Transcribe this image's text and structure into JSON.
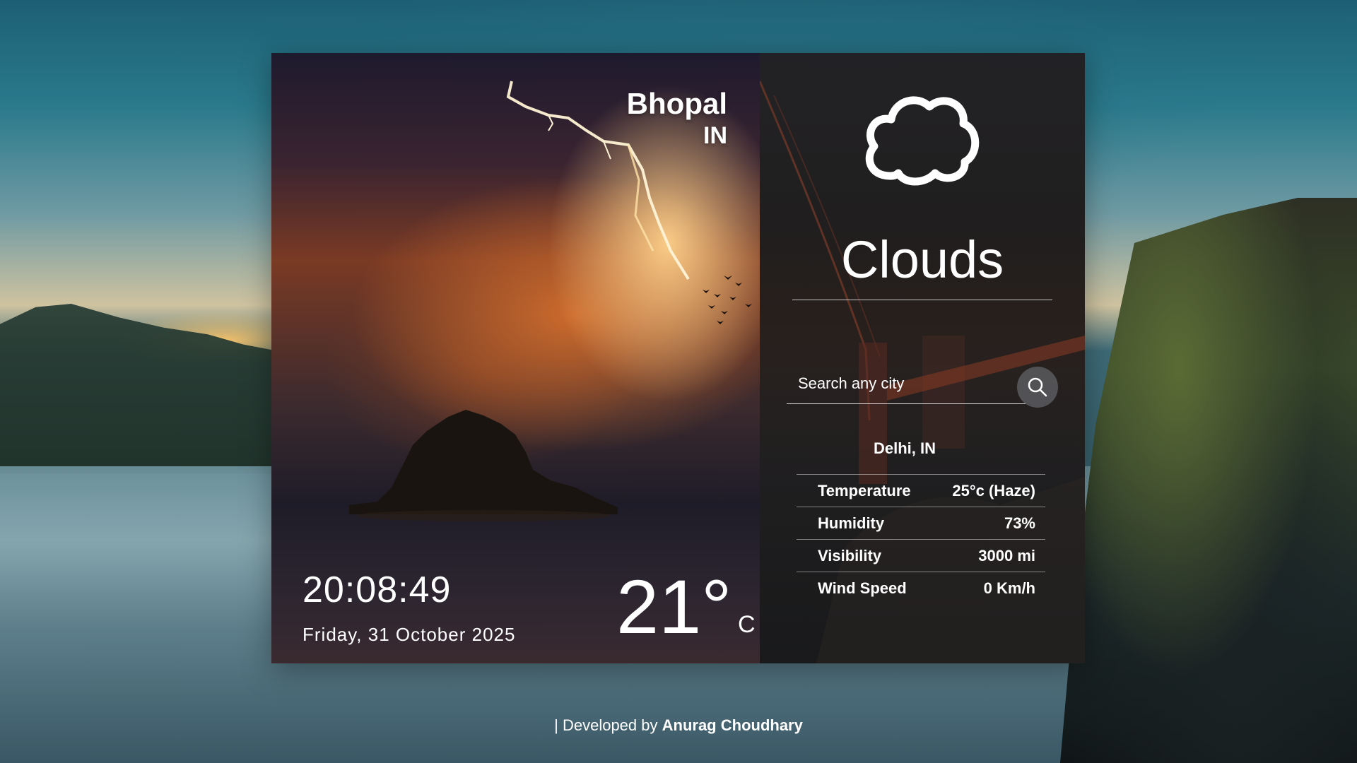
{
  "location_panel": {
    "city": "Bhopal",
    "country": "IN",
    "time": "20:08:49",
    "date": "Friday, 31 October 2025",
    "temperature": "21°",
    "temperature_unit": "C"
  },
  "weather_panel": {
    "icon": "cloud-icon",
    "condition": "Clouds",
    "search": {
      "placeholder": "Search any city"
    },
    "result_location": "Delhi, IN",
    "stats": [
      {
        "label": "Temperature",
        "value": "25°c (Haze)"
      },
      {
        "label": "Humidity",
        "value": "73%"
      },
      {
        "label": "Visibility",
        "value": "3000 mi"
      },
      {
        "label": "Wind Speed",
        "value": "0 Km/h"
      }
    ]
  },
  "footer": {
    "prefix": "| Developed by ",
    "author": "Anurag Choudhary"
  },
  "colors": {
    "text": "#ffffff",
    "panel_overlay": "#2b2826",
    "search_button": "#5a5a5f"
  }
}
